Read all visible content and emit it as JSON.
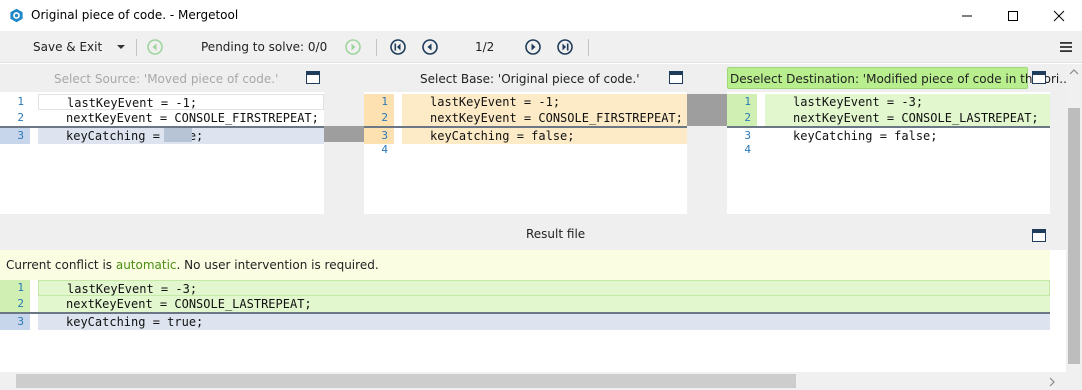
{
  "window": {
    "title": "Original piece of code. - Mergetool",
    "minimize_icon": "minimize-icon",
    "maximize_icon": "maximize-icon",
    "close_icon": "close-icon"
  },
  "toolbar": {
    "save_exit_label": "Save & Exit",
    "pending_label": "Pending to solve: 0/0",
    "page_counter": "1/2"
  },
  "panes": {
    "source": {
      "header": "Select Source: 'Moved piece of code.'",
      "lines": [
        {
          "num": "1",
          "text": "lastKeyEvent = -1;"
        },
        {
          "num": "2",
          "text": "nextKeyEvent = CONSOLE_FIRSTREPEAT;"
        },
        {
          "num": "3",
          "text": "keyCatching = true;"
        }
      ]
    },
    "base": {
      "header": "Select Base: 'Original piece of code.'",
      "lines": [
        {
          "num": "1",
          "text": "lastKeyEvent = -1;"
        },
        {
          "num": "2",
          "text": "nextKeyEvent = CONSOLE_FIRSTREPEAT;"
        },
        {
          "num": "3",
          "text": "keyCatching = false;"
        },
        {
          "num": "4",
          "text": ""
        }
      ]
    },
    "destination": {
      "header": "Deselect Destination: 'Modified piece of code in the ori...",
      "lines": [
        {
          "num": "1",
          "text": "lastKeyEvent = -3;"
        },
        {
          "num": "2",
          "text": "nextKeyEvent = CONSOLE_LASTREPEAT;"
        },
        {
          "num": "3",
          "text": "keyCatching = false;"
        },
        {
          "num": "4",
          "text": ""
        }
      ]
    }
  },
  "result": {
    "header": "Result file",
    "status_prefix": "Current conflict is ",
    "status_keyword": "automatic",
    "status_suffix": ". No user intervention is required.",
    "lines": [
      {
        "num": "1",
        "text": "lastKeyEvent = -3;"
      },
      {
        "num": "2",
        "text": "nextKeyEvent = CONSOLE_LASTREPEAT;"
      },
      {
        "num": "3",
        "text": "keyCatching = true;"
      }
    ]
  },
  "colors": {
    "accent_blue": "#2a78b6",
    "green_line": "#e3f7cf",
    "orange_line": "#fdebc8",
    "blue_line": "#dde4ef",
    "automatic_text": "#4a8f12"
  }
}
